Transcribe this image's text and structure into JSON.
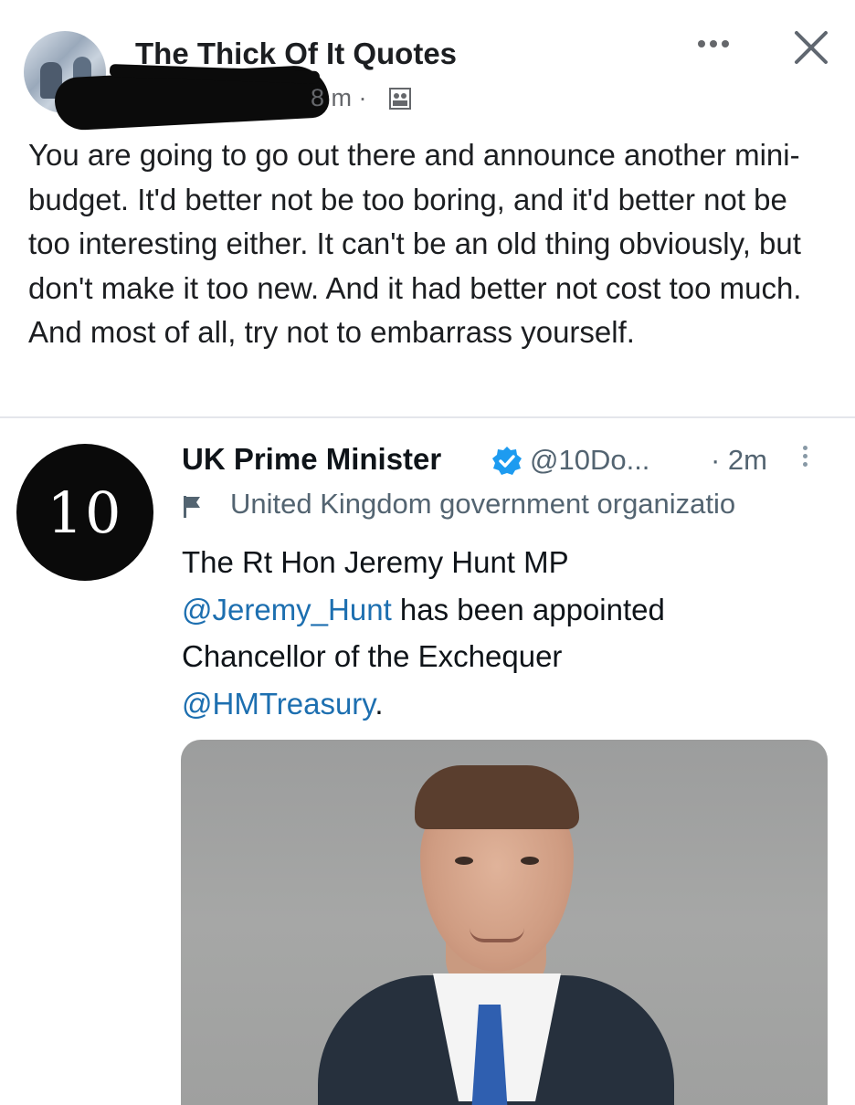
{
  "post": {
    "page_name": "The Thick Of It Quotes",
    "timestamp": "8 m ·",
    "text": "You are going to go out there and announce another mini-budget. It'd better not be too boring, and it'd better not be too interesting either. It can't be an old thing obviously, but don't make it too new. And it had better not cost too much. And most of all, try not to embarrass yourself.",
    "icons": {
      "more": "more-horizontal-icon",
      "close": "close-icon",
      "audience": "audience-icon"
    }
  },
  "tweet": {
    "avatar_text": "10",
    "name": "UK Prime Minister",
    "handle": "@10Do...",
    "time": "· 2m",
    "label": "United Kingdom government organizatio",
    "text_part1": "The Rt Hon Jeremy Hunt MP",
    "mention1": "@Jeremy_Hunt",
    "text_part2": " has been appointed",
    "text_part3": "Chancellor of the Exchequer",
    "mention2": "@HMTreasury",
    "text_part4": ".",
    "colors": {
      "mention": "#1d6fb0",
      "verified": "#1d9bf0"
    }
  }
}
